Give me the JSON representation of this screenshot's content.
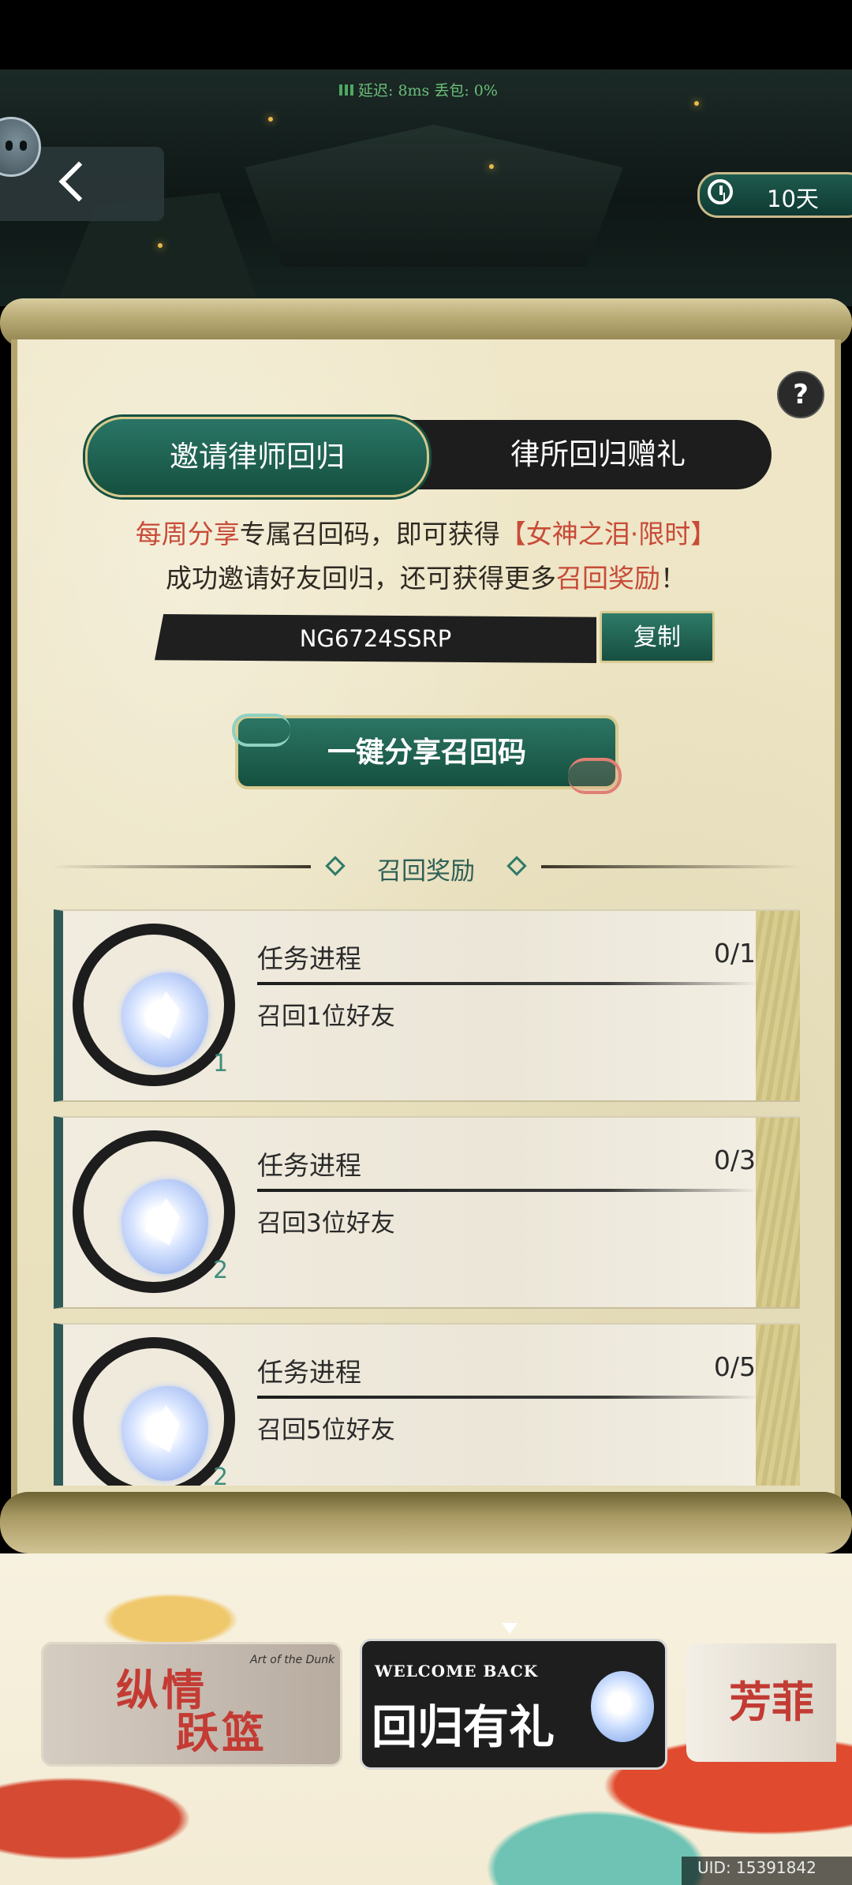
{
  "status": {
    "network": "延迟: 8ms  丢包: 0%"
  },
  "timer": {
    "value": "10天"
  },
  "help": {
    "label": "?"
  },
  "tabs": [
    {
      "label": "邀请律师回归",
      "active": true
    },
    {
      "label": "律所回归赠礼",
      "active": false
    }
  ],
  "intro": {
    "line1_a": "每周分享",
    "line1_b": "专属召回码，即可获得",
    "line1_c": "【女神之泪·限时】",
    "line2_a": "成功邀请好友回归，还可获得更多",
    "line2_b": "召回奖励",
    "line2_c": "！"
  },
  "code": {
    "value": "NG6724SSRP",
    "copy_label": "复制"
  },
  "share": {
    "label": "一键分享召回码"
  },
  "rewards_header": "召回奖励",
  "tasks": [
    {
      "title": "任务进程",
      "progress": "0/1",
      "desc": "召回1位好友",
      "count": "1"
    },
    {
      "title": "任务进程",
      "progress": "0/3",
      "desc": "召回3位好友",
      "count": "2"
    },
    {
      "title": "任务进程",
      "progress": "0/5",
      "desc": "召回5位好友",
      "count": "2"
    }
  ],
  "banners": {
    "prev_title1": "纵情",
    "prev_title2": "跃篮",
    "prev_en": "Art of the Dunk",
    "current_en": "WELCOME BACK",
    "current_zh": "回归有礼",
    "next_title": "芳菲"
  },
  "uid": "UID: 15391842",
  "colors": {
    "accent_green": "#15503f",
    "highlight_red": "#c84b38",
    "parchment": "#efe7c8"
  }
}
